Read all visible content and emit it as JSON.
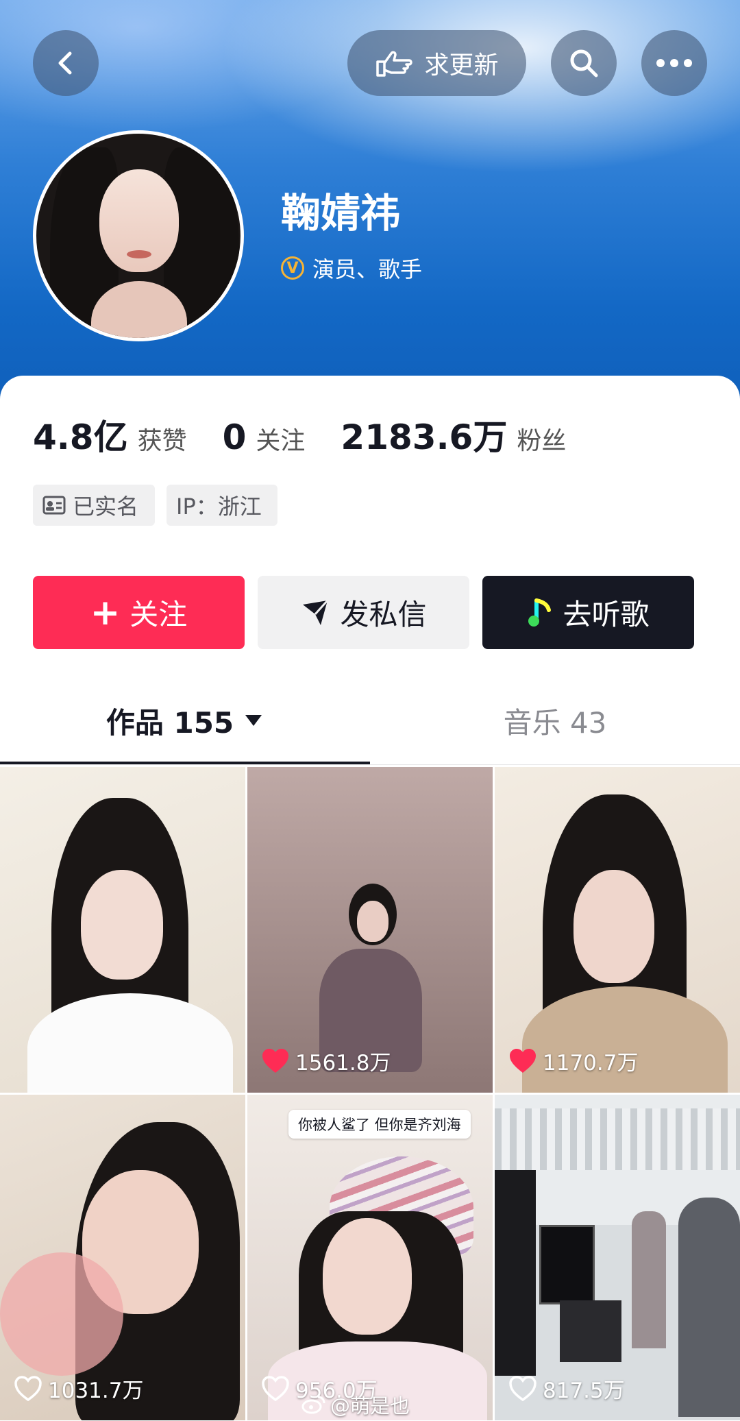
{
  "header": {
    "update_label": "求更新"
  },
  "profile": {
    "name": "鞠婧祎",
    "verified_title": "演员、歌手",
    "verify_badge": "V"
  },
  "stats": {
    "likes_value": "4.8亿",
    "likes_label": "获赞",
    "following_value": "0",
    "following_label": "关注",
    "followers_value": "2183.6万",
    "followers_label": "粉丝"
  },
  "tags": {
    "real_name": "已实名",
    "ip": "IP：浙江"
  },
  "actions": {
    "follow": "关注",
    "follow_symbol": "+",
    "message": "发私信",
    "listen": "去听歌"
  },
  "tabs": {
    "works": "作品 155",
    "music": "音乐 43"
  },
  "videos": [
    {
      "likes": ""
    },
    {
      "likes": "1561.8万",
      "liked": true
    },
    {
      "likes": "1170.7万",
      "liked": true
    },
    {
      "likes": "1031.7万",
      "liked": false
    },
    {
      "likes": "956.0万",
      "liked": false,
      "caption": "你被人鲨了 但你是齐刘海"
    },
    {
      "likes": "817.5万",
      "liked": false
    }
  ],
  "watermark": "@萌是也",
  "colors": {
    "accent": "#fe2c55",
    "header_blue": "#1368c5",
    "dark_button": "#161823",
    "verify_gold": "#f5b335"
  }
}
